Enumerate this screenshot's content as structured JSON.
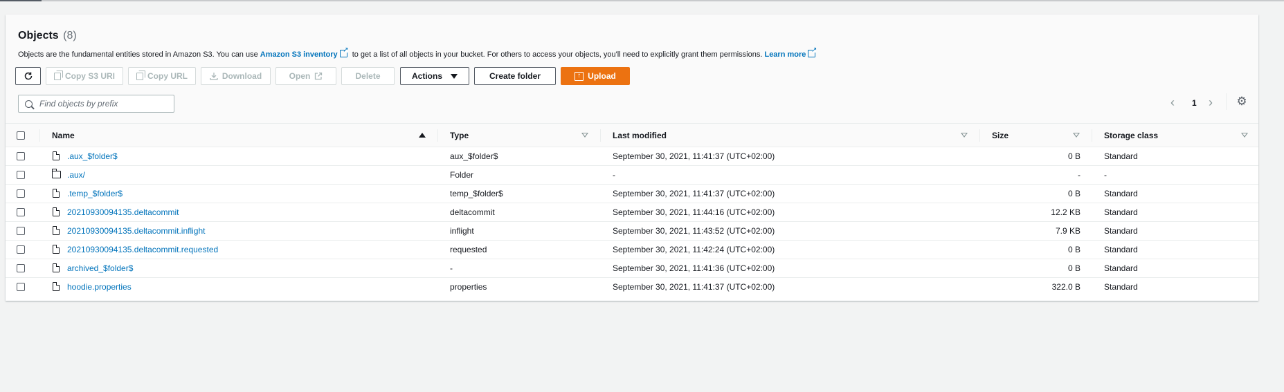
{
  "header": {
    "title": "Objects",
    "count": "(8)",
    "desc_part1": "Objects are the fundamental entities stored in Amazon S3. You can use ",
    "desc_link1": "Amazon S3 inventory",
    "desc_part2": " to get a list of all objects in your bucket. For others to access your objects, you'll need to explicitly grant them permissions. ",
    "desc_link2": "Learn more"
  },
  "toolbar": {
    "copy_s3_uri": "Copy S3 URI",
    "copy_url": "Copy URL",
    "download": "Download",
    "open": "Open",
    "delete": "Delete",
    "actions": "Actions",
    "create_folder": "Create folder",
    "upload": "Upload"
  },
  "search": {
    "placeholder": "Find objects by prefix"
  },
  "pagination": {
    "page": "1"
  },
  "columns": {
    "name": "Name",
    "type": "Type",
    "last_modified": "Last modified",
    "size": "Size",
    "storage_class": "Storage class"
  },
  "rows": [
    {
      "name": ".aux_$folder$",
      "icon": "file-icon",
      "type": "aux_$folder$",
      "modified": "September 30, 2021, 11:41:37 (UTC+02:00)",
      "size": "0 B",
      "storage": "Standard"
    },
    {
      "name": ".aux/",
      "icon": "folder-icon",
      "type": "Folder",
      "modified": "-",
      "size": "-",
      "storage": "-"
    },
    {
      "name": ".temp_$folder$",
      "icon": "file-icon",
      "type": "temp_$folder$",
      "modified": "September 30, 2021, 11:41:37 (UTC+02:00)",
      "size": "0 B",
      "storage": "Standard"
    },
    {
      "name": "20210930094135.deltacommit",
      "icon": "file-icon",
      "type": "deltacommit",
      "modified": "September 30, 2021, 11:44:16 (UTC+02:00)",
      "size": "12.2 KB",
      "storage": "Standard"
    },
    {
      "name": "20210930094135.deltacommit.inflight",
      "icon": "file-icon",
      "type": "inflight",
      "modified": "September 30, 2021, 11:43:52 (UTC+02:00)",
      "size": "7.9 KB",
      "storage": "Standard"
    },
    {
      "name": "20210930094135.deltacommit.requested",
      "icon": "file-icon",
      "type": "requested",
      "modified": "September 30, 2021, 11:42:24 (UTC+02:00)",
      "size": "0 B",
      "storage": "Standard"
    },
    {
      "name": "archived_$folder$",
      "icon": "file-icon",
      "type": "-",
      "modified": "September 30, 2021, 11:41:36 (UTC+02:00)",
      "size": "0 B",
      "storage": "Standard"
    },
    {
      "name": "hoodie.properties",
      "icon": "file-icon",
      "type": "properties",
      "modified": "September 30, 2021, 11:41:37 (UTC+02:00)",
      "size": "322.0 B",
      "storage": "Standard"
    }
  ],
  "colors": {
    "accent": "#0073bb",
    "primary": "#ec7211"
  }
}
